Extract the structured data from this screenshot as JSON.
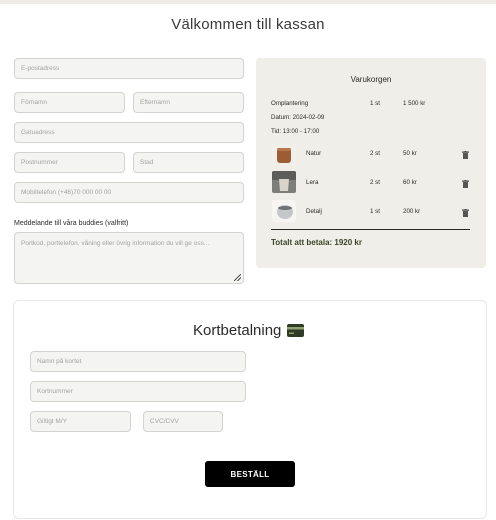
{
  "page": {
    "title": "Välkommen till kassan"
  },
  "checkout_form": {
    "email_placeholder": "E-postadress",
    "first_name_placeholder": "Förnamn",
    "last_name_placeholder": "Efternamn",
    "street_placeholder": "Gatuadress",
    "postcode_placeholder": "Postnummer",
    "city_placeholder": "Stad",
    "phone_placeholder": "Mobiltelefon (+46)70 000 00 00",
    "message_label": "Meddelande till våra buddies (valfritt)",
    "message_placeholder": "Portkod, porttelefon, våning eller övrig information du vill ge oss..."
  },
  "cart": {
    "title": "Varukorgen",
    "service": {
      "name": "Omplantering",
      "qty": "1 st",
      "price": "1 500 kr",
      "date": "Datum: 2024-02-09",
      "time": "Tid: 13:00 - 17:00"
    },
    "items": [
      {
        "name": "Natur",
        "qty": "2 st",
        "price": "50 kr",
        "image": "terracotta-pot",
        "icon": "trash-icon"
      },
      {
        "name": "Lera",
        "qty": "2 st",
        "price": "60 kr",
        "image": "clay-pot",
        "icon": "trash-icon"
      },
      {
        "name": "Detalj",
        "qty": "1 st",
        "price": "200 kr",
        "image": "ceramic-pot",
        "icon": "trash-icon"
      }
    ],
    "total": "Totalt att betala: 1920 kr"
  },
  "payment": {
    "title": "Kortbetalning",
    "icon": "credit-card-icon",
    "name_placeholder": "Namn på kortet",
    "number_placeholder": "Kortnummer",
    "expiry_placeholder": "Giltigt M/Y",
    "cvc_placeholder": "CVC/CVV",
    "submit_label": "BESTÄLL"
  },
  "colors": {
    "cart_background": "#efeee8",
    "total_text": "#3a4326",
    "card_icon": "#2f3c25",
    "button": "#000000"
  }
}
